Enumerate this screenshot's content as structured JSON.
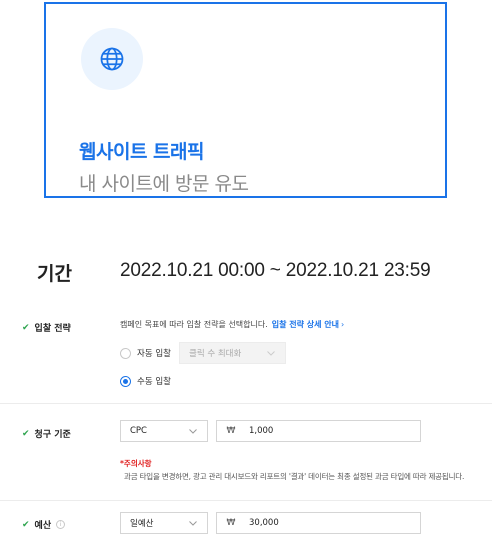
{
  "objective_card": {
    "icon": "globe-icon",
    "title": "웹사이트 트래픽",
    "subtitle": "내 사이트에 방문 유도",
    "border_color": "#1a73e8"
  },
  "period": {
    "label": "기간",
    "value": "2022.10.21 00:00 ~ 2022.10.21 23:59"
  },
  "bid_strategy": {
    "label": "입찰 전략",
    "description": "캠페인 목표에 따라 입찰 전략을 선택합니다.",
    "guide_link": "입찰 전략 상세 안내",
    "auto_label": "자동 입찰",
    "auto_select_value": "클릭 수 최대화",
    "manual_label": "수동 입찰",
    "selected": "manual"
  },
  "billing": {
    "label": "청구 기준",
    "type_value": "CPC",
    "currency": "₩",
    "amount": "1,000",
    "notice_title": "*주의사항",
    "notice_body": "과금 타입을 변경하면, 광고 관리 대시보드와 리포트의 '결과' 데이터는 최종 설정된 과금 타입에 따라 제공됩니다."
  },
  "budget": {
    "label": "예산",
    "type_value": "일예산",
    "currency": "₩",
    "amount": "30,000"
  },
  "colors": {
    "accent": "#1a73e8",
    "check": "#2ea44f",
    "warning": "#e02020"
  }
}
